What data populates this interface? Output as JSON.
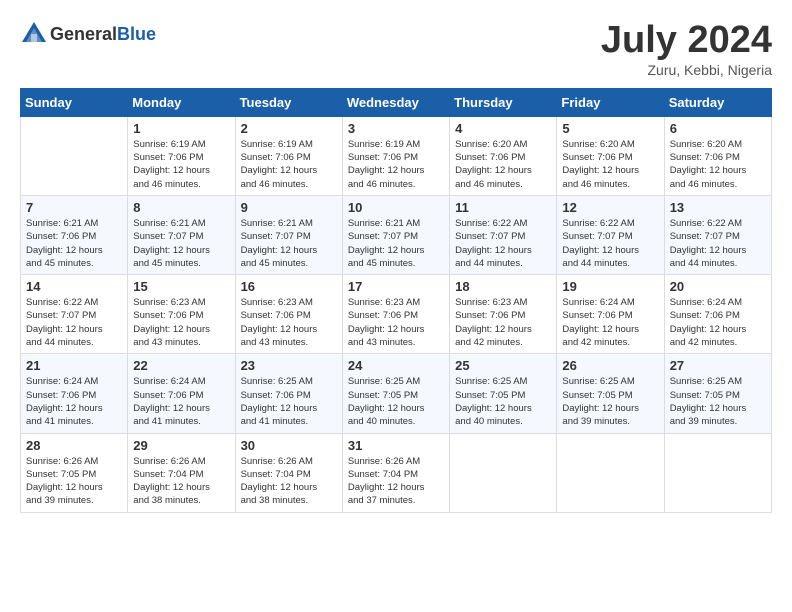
{
  "header": {
    "logo": {
      "text_general": "General",
      "text_blue": "Blue"
    },
    "title": "July 2024",
    "location": "Zuru, Kebbi, Nigeria"
  },
  "calendar": {
    "columns": [
      "Sunday",
      "Monday",
      "Tuesday",
      "Wednesday",
      "Thursday",
      "Friday",
      "Saturday"
    ],
    "weeks": [
      [
        {
          "day": "",
          "info": ""
        },
        {
          "day": "1",
          "info": "Sunrise: 6:19 AM\nSunset: 7:06 PM\nDaylight: 12 hours\nand 46 minutes."
        },
        {
          "day": "2",
          "info": "Sunrise: 6:19 AM\nSunset: 7:06 PM\nDaylight: 12 hours\nand 46 minutes."
        },
        {
          "day": "3",
          "info": "Sunrise: 6:19 AM\nSunset: 7:06 PM\nDaylight: 12 hours\nand 46 minutes."
        },
        {
          "day": "4",
          "info": "Sunrise: 6:20 AM\nSunset: 7:06 PM\nDaylight: 12 hours\nand 46 minutes."
        },
        {
          "day": "5",
          "info": "Sunrise: 6:20 AM\nSunset: 7:06 PM\nDaylight: 12 hours\nand 46 minutes."
        },
        {
          "day": "6",
          "info": "Sunrise: 6:20 AM\nSunset: 7:06 PM\nDaylight: 12 hours\nand 46 minutes."
        }
      ],
      [
        {
          "day": "7",
          "info": "Sunrise: 6:21 AM\nSunset: 7:06 PM\nDaylight: 12 hours\nand 45 minutes."
        },
        {
          "day": "8",
          "info": "Sunrise: 6:21 AM\nSunset: 7:07 PM\nDaylight: 12 hours\nand 45 minutes."
        },
        {
          "day": "9",
          "info": "Sunrise: 6:21 AM\nSunset: 7:07 PM\nDaylight: 12 hours\nand 45 minutes."
        },
        {
          "day": "10",
          "info": "Sunrise: 6:21 AM\nSunset: 7:07 PM\nDaylight: 12 hours\nand 45 minutes."
        },
        {
          "day": "11",
          "info": "Sunrise: 6:22 AM\nSunset: 7:07 PM\nDaylight: 12 hours\nand 44 minutes."
        },
        {
          "day": "12",
          "info": "Sunrise: 6:22 AM\nSunset: 7:07 PM\nDaylight: 12 hours\nand 44 minutes."
        },
        {
          "day": "13",
          "info": "Sunrise: 6:22 AM\nSunset: 7:07 PM\nDaylight: 12 hours\nand 44 minutes."
        }
      ],
      [
        {
          "day": "14",
          "info": "Sunrise: 6:22 AM\nSunset: 7:07 PM\nDaylight: 12 hours\nand 44 minutes."
        },
        {
          "day": "15",
          "info": "Sunrise: 6:23 AM\nSunset: 7:06 PM\nDaylight: 12 hours\nand 43 minutes."
        },
        {
          "day": "16",
          "info": "Sunrise: 6:23 AM\nSunset: 7:06 PM\nDaylight: 12 hours\nand 43 minutes."
        },
        {
          "day": "17",
          "info": "Sunrise: 6:23 AM\nSunset: 7:06 PM\nDaylight: 12 hours\nand 43 minutes."
        },
        {
          "day": "18",
          "info": "Sunrise: 6:23 AM\nSunset: 7:06 PM\nDaylight: 12 hours\nand 42 minutes."
        },
        {
          "day": "19",
          "info": "Sunrise: 6:24 AM\nSunset: 7:06 PM\nDaylight: 12 hours\nand 42 minutes."
        },
        {
          "day": "20",
          "info": "Sunrise: 6:24 AM\nSunset: 7:06 PM\nDaylight: 12 hours\nand 42 minutes."
        }
      ],
      [
        {
          "day": "21",
          "info": "Sunrise: 6:24 AM\nSunset: 7:06 PM\nDaylight: 12 hours\nand 41 minutes."
        },
        {
          "day": "22",
          "info": "Sunrise: 6:24 AM\nSunset: 7:06 PM\nDaylight: 12 hours\nand 41 minutes."
        },
        {
          "day": "23",
          "info": "Sunrise: 6:25 AM\nSunset: 7:06 PM\nDaylight: 12 hours\nand 41 minutes."
        },
        {
          "day": "24",
          "info": "Sunrise: 6:25 AM\nSunset: 7:05 PM\nDaylight: 12 hours\nand 40 minutes."
        },
        {
          "day": "25",
          "info": "Sunrise: 6:25 AM\nSunset: 7:05 PM\nDaylight: 12 hours\nand 40 minutes."
        },
        {
          "day": "26",
          "info": "Sunrise: 6:25 AM\nSunset: 7:05 PM\nDaylight: 12 hours\nand 39 minutes."
        },
        {
          "day": "27",
          "info": "Sunrise: 6:25 AM\nSunset: 7:05 PM\nDaylight: 12 hours\nand 39 minutes."
        }
      ],
      [
        {
          "day": "28",
          "info": "Sunrise: 6:26 AM\nSunset: 7:05 PM\nDaylight: 12 hours\nand 39 minutes."
        },
        {
          "day": "29",
          "info": "Sunrise: 6:26 AM\nSunset: 7:04 PM\nDaylight: 12 hours\nand 38 minutes."
        },
        {
          "day": "30",
          "info": "Sunrise: 6:26 AM\nSunset: 7:04 PM\nDaylight: 12 hours\nand 38 minutes."
        },
        {
          "day": "31",
          "info": "Sunrise: 6:26 AM\nSunset: 7:04 PM\nDaylight: 12 hours\nand 37 minutes."
        },
        {
          "day": "",
          "info": ""
        },
        {
          "day": "",
          "info": ""
        },
        {
          "day": "",
          "info": ""
        }
      ]
    ]
  }
}
